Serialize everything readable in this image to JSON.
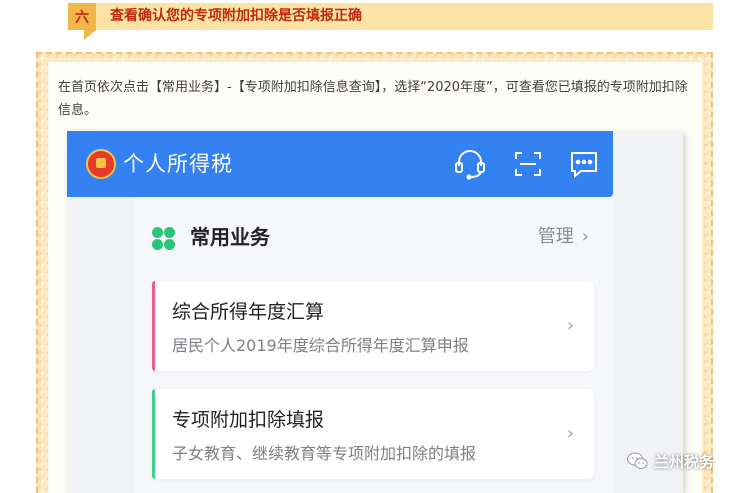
{
  "section": {
    "number": "六",
    "title": "查看确认您的专项附加扣除是否填报正确"
  },
  "intro_text": "在首页依次点击【常用业务】-【专项附加扣除信息查询】，选择“2020年度”，可查看您已填报的专项附加扣除信息。",
  "app": {
    "title": "个人所得税",
    "icons": [
      "customer-service-icon",
      "scan-icon",
      "message-icon"
    ]
  },
  "common_business": {
    "label": "常用业务",
    "manage": "管理",
    "cards": [
      {
        "title": "综合所得年度汇算",
        "subtitle": "居民个人2019年度综合所得年度汇算申报",
        "accent": "#ee5d8a"
      },
      {
        "title": "专项附加扣除填报",
        "subtitle": "子女教育、继续教育等专项附加扣除的填报",
        "accent": "#3ecf8e"
      }
    ]
  },
  "watermark": "兰州税务",
  "colors": {
    "app_bar": "#3481f2",
    "header_red": "#c12a0e",
    "header_bg": "#fbe3a6"
  }
}
